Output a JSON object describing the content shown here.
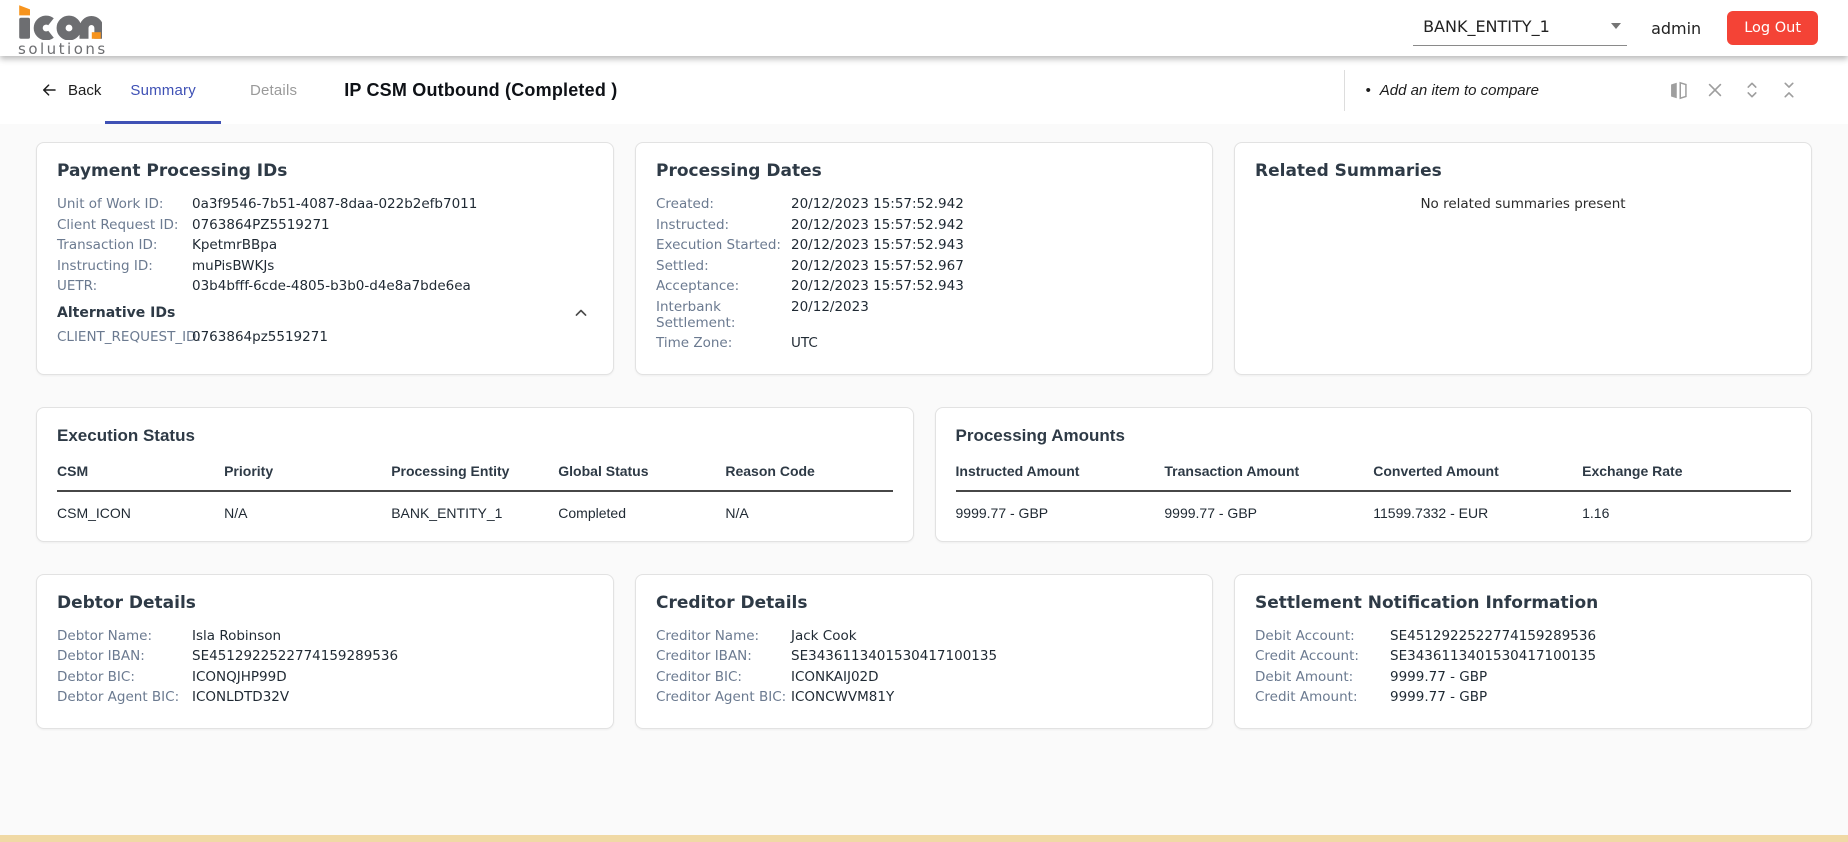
{
  "header": {
    "logo": {
      "name": "icon",
      "tagline": "solutions"
    },
    "entity_selector": {
      "value": "BANK_ENTITY_1"
    },
    "user": "admin",
    "logout": "Log Out"
  },
  "toolbar": {
    "back": "Back",
    "tabs": {
      "summary": "Summary",
      "details": "Details"
    },
    "page_title": "IP CSM Outbound (Completed )",
    "compare_hint": "Add an item to compare"
  },
  "icons": {
    "bullet": "•",
    "back_arrow": "arrow-left-icon",
    "caret_down": "caret-down-icon",
    "compare": "compare-icon",
    "close": "close-icon",
    "unfold_more": "unfold-more-icon",
    "unfold_less": "unfold-less-icon",
    "collapse": "chevron-up-icon"
  },
  "colors": {
    "accent_blue": "#3f51b5",
    "logout_red": "#f44336",
    "logo_orange": "#f7941d",
    "logo_gray": "#6d6e71",
    "label_text": "#6b7a90",
    "value_text": "#1f2933",
    "bottom_bar": "#f0d9a5"
  },
  "payment_processing_ids": {
    "title": "Payment Processing IDs",
    "fields": [
      {
        "label": "Unit of Work ID:",
        "value": "0a3f9546-7b51-4087-8daa-022b2efb7011"
      },
      {
        "label": "Client Request ID:",
        "value": "0763864PZ5519271"
      },
      {
        "label": "Transaction ID:",
        "value": "KpetmrBBpa"
      },
      {
        "label": "Instructing ID:",
        "value": "muPisBWKJs"
      },
      {
        "label": "UETR:",
        "value": "03b4bfff-6cde-4805-b3b0-d4e8a7bde6ea"
      }
    ],
    "alternative_ids": {
      "title": "Alternative IDs",
      "fields": [
        {
          "label": "CLIENT_REQUEST_ID:",
          "value": "0763864pz5519271"
        }
      ]
    }
  },
  "processing_dates": {
    "title": "Processing Dates",
    "fields": [
      {
        "label": "Created:",
        "value": "20/12/2023 15:57:52.942"
      },
      {
        "label": "Instructed:",
        "value": "20/12/2023 15:57:52.942"
      },
      {
        "label": "Execution Started:",
        "value": "20/12/2023 15:57:52.943"
      },
      {
        "label": "Settled:",
        "value": "20/12/2023 15:57:52.967"
      },
      {
        "label": "Acceptance:",
        "value": "20/12/2023 15:57:52.943"
      },
      {
        "label": "Interbank Settlement:",
        "value": "20/12/2023"
      },
      {
        "label": "Time Zone:",
        "value": "UTC"
      }
    ]
  },
  "related_summaries": {
    "title": "Related Summaries",
    "empty_message": "No related summaries present"
  },
  "execution_status": {
    "title": "Execution Status",
    "columns": [
      "CSM",
      "Priority",
      "Processing Entity",
      "Global Status",
      "Reason Code"
    ],
    "row": [
      "CSM_ICON",
      "N/A",
      "BANK_ENTITY_1",
      "Completed",
      "N/A"
    ]
  },
  "processing_amounts": {
    "title": "Processing Amounts",
    "columns": [
      "Instructed Amount",
      "Transaction Amount",
      "Converted Amount",
      "Exchange Rate"
    ],
    "row": [
      "9999.77 - GBP",
      "9999.77 - GBP",
      "11599.7332 - EUR",
      "1.16"
    ]
  },
  "debtor_details": {
    "title": "Debtor Details",
    "fields": [
      {
        "label": "Debtor Name:",
        "value": "Isla Robinson"
      },
      {
        "label": "Debtor IBAN:",
        "value": "SE4512922522774159289536"
      },
      {
        "label": "Debtor BIC:",
        "value": "ICONQJHP99D"
      },
      {
        "label": "Debtor Agent BIC:",
        "value": "ICONLDTD32V"
      }
    ]
  },
  "creditor_details": {
    "title": "Creditor Details",
    "fields": [
      {
        "label": "Creditor Name:",
        "value": "Jack Cook"
      },
      {
        "label": "Creditor IBAN:",
        "value": "SE3436113401530417100135"
      },
      {
        "label": "Creditor BIC:",
        "value": "ICONKAIJ02D"
      },
      {
        "label": "Creditor Agent BIC:",
        "value": "ICONCWVM81Y"
      }
    ]
  },
  "settlement_notification": {
    "title": "Settlement Notification Information",
    "fields": [
      {
        "label": "Debit Account:",
        "value": "SE4512922522774159289536"
      },
      {
        "label": "Credit Account:",
        "value": "SE3436113401530417100135"
      },
      {
        "label": "Debit Amount:",
        "value": "9999.77 - GBP"
      },
      {
        "label": "Credit Amount:",
        "value": "9999.77 - GBP"
      }
    ]
  }
}
